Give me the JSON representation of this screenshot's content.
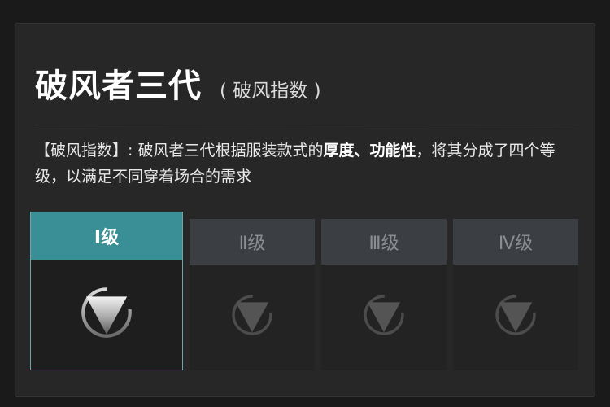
{
  "header": {
    "title": "破风者三代",
    "subtitle": "( 破风指数 )"
  },
  "description": {
    "label": "【破风指数】",
    "colon": ":",
    "text1": "破风者三代根据服装款式的",
    "bold1": "厚度",
    "sep": "、",
    "bold2": "功能性",
    "text2": "，将其分成了四个等级，以满足不同穿着场合的需求"
  },
  "levels": [
    {
      "label": "Ⅰ级",
      "selected": true,
      "icon": "triangle-emblem-icon"
    },
    {
      "label": "Ⅱ级",
      "selected": false,
      "icon": "triangle-emblem-icon"
    },
    {
      "label": "Ⅲ级",
      "selected": false,
      "icon": "triangle-emblem-icon"
    },
    {
      "label": "Ⅳ级",
      "selected": false,
      "icon": "triangle-emblem-icon"
    }
  ],
  "colors": {
    "accent": "#3a8e95",
    "panel": "#272727",
    "inactive_tab": "#3b3f43"
  }
}
